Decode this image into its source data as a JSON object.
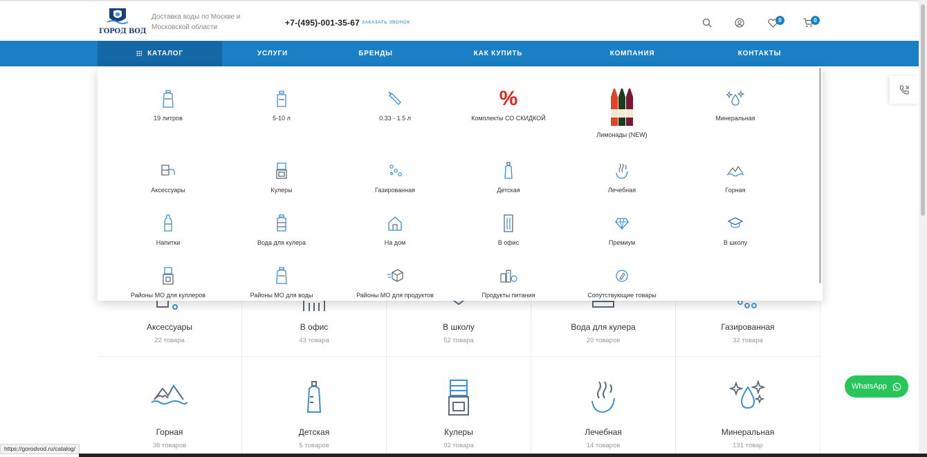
{
  "header": {
    "logo_text": "ГОРОД ВОД",
    "tagline": "Доставка воды по Москве и Московской области",
    "phone": "+7-(495)-001-35-67",
    "callback_label": "ЗАКАЗАТЬ ЗВОНОК",
    "icons": [
      "search-icon",
      "user-icon",
      "heart-icon",
      "cart-icon"
    ],
    "favorites_count": "0",
    "cart_count": "0"
  },
  "nav": {
    "items": [
      {
        "label": "КАТАЛОГ"
      },
      {
        "label": "УСЛУГИ"
      },
      {
        "label": "БРЕНДЫ"
      },
      {
        "label": "КАК КУПИТЬ"
      },
      {
        "label": "КОМПАНИЯ"
      },
      {
        "label": "КОНТАКТЫ"
      }
    ]
  },
  "dropdown": {
    "items": [
      {
        "label": "19 литров",
        "icon": "bottle-19l-icon"
      },
      {
        "label": "5-10 л",
        "icon": "bottle-5l-icon"
      },
      {
        "label": "0.33 - 1.5 л",
        "icon": "small-bottle-icon"
      },
      {
        "label": "Комплекты СО СКИДКОЙ",
        "icon": "percent-icon"
      },
      {
        "label": "Лимонады (NEW)",
        "icon": "lemonade-bottles-image"
      },
      {
        "label": "Минеральная",
        "icon": "mineral-drop-icon"
      },
      {
        "label": "Аксессуары",
        "icon": "pump-icon"
      },
      {
        "label": "Кулеры",
        "icon": "cooler-icon"
      },
      {
        "label": "Газированная",
        "icon": "bubbles-icon"
      },
      {
        "label": "Детская",
        "icon": "baby-bottle-icon"
      },
      {
        "label": "Лечебная",
        "icon": "healing-water-icon"
      },
      {
        "label": "Горная",
        "icon": "mountain-icon"
      },
      {
        "label": "Напитки",
        "icon": "drink-bottle-icon"
      },
      {
        "label": "Вода для кулера",
        "icon": "cooler-bottle-icon"
      },
      {
        "label": "На дом",
        "icon": "house-icon"
      },
      {
        "label": "В офис",
        "icon": "office-building-icon"
      },
      {
        "label": "Премиум",
        "icon": "diamond-icon"
      },
      {
        "label": "В школу",
        "icon": "graduation-cap-icon"
      },
      {
        "label": "Районы МО для куллеров",
        "icon": "cooler-dispenser-icon"
      },
      {
        "label": "Районы МО для воды",
        "icon": "bottle-19l-icon"
      },
      {
        "label": "Районы МО для продуктов",
        "icon": "box-delivery-icon"
      },
      {
        "label": "Продукты питания",
        "icon": "groceries-icon"
      },
      {
        "label": "Сопутствующие товары",
        "icon": "tag-icon"
      }
    ]
  },
  "catalog_grid": {
    "row1": [
      {
        "name": "Аксессуары",
        "count": "22 товара"
      },
      {
        "name": "В офис",
        "count": "43 товара"
      },
      {
        "name": "В школу",
        "count": "52 товара"
      },
      {
        "name": "Вода для кулера",
        "count": "20 товаров"
      },
      {
        "name": "Газированная",
        "count": "32 товара"
      }
    ],
    "row2": [
      {
        "name": "Горная",
        "count": "38 товаров"
      },
      {
        "name": "Детская",
        "count": "5 товаров"
      },
      {
        "name": "Кулеры",
        "count": "92 товара"
      },
      {
        "name": "Лечебная",
        "count": "14 товаров"
      },
      {
        "name": "Минеральная",
        "count": "131 товар"
      }
    ]
  },
  "whatsapp": {
    "label": "WhatsApp"
  },
  "status_url": "https://gorodvod.ru/catalog/",
  "colors": {
    "brand_blue": "#1a7fc4",
    "nav_active": "#1468a6",
    "whatsapp_green": "#28c65a",
    "percent_red": "#e52521"
  }
}
